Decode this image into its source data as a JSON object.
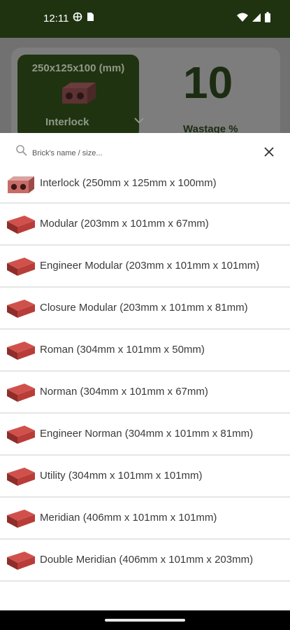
{
  "status": {
    "time": "12:11",
    "icons": [
      "vpn-globe-icon",
      "sim-card-icon",
      "wifi-icon",
      "signal-icon",
      "battery-icon"
    ]
  },
  "background": {
    "brick_card": {
      "size": "250x125x100 (mm)",
      "name": "Interlock"
    },
    "wastage": {
      "value": "10",
      "label": "Wastage %"
    }
  },
  "search": {
    "placeholder": "Brick's name / size..."
  },
  "bricks": [
    {
      "label": "Interlock (250mm x 125mm x 100mm)",
      "icon": "interlock-brick-icon"
    },
    {
      "label": "Modular (203mm x 101mm x 67mm)",
      "icon": "brick-icon"
    },
    {
      "label": "Engineer Modular (203mm x 101mm x 101mm)",
      "icon": "brick-icon"
    },
    {
      "label": "Closure Modular (203mm x 101mm x 81mm)",
      "icon": "brick-icon"
    },
    {
      "label": "Roman (304mm x 101mm x 50mm)",
      "icon": "brick-icon"
    },
    {
      "label": "Norman (304mm x 101mm x 67mm)",
      "icon": "brick-icon"
    },
    {
      "label": "Engineer Norman (304mm x 101mm x 81mm)",
      "icon": "brick-icon"
    },
    {
      "label": "Utility (304mm x 101mm x 101mm)",
      "icon": "brick-icon"
    },
    {
      "label": "Meridian (406mm x 101mm x 101mm)",
      "icon": "brick-icon"
    },
    {
      "label": "Double Meridian (406mm x 101mm x 203mm)",
      "icon": "brick-icon"
    }
  ],
  "colors": {
    "header": "#1f3311",
    "brick": "#b83c3a",
    "overlay": "#717171"
  }
}
